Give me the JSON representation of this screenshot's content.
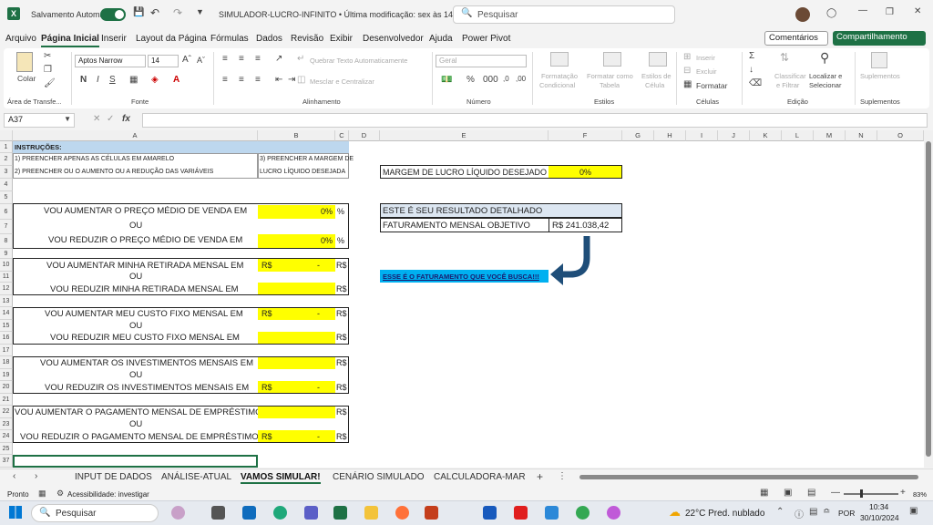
{
  "titlebar": {
    "autosave_label": "Salvamento Automático",
    "doc_title": "SIMULADOR-LUCRO-INFINITO • Última modificação: sex às 14:14",
    "search_placeholder": "Pesquisar"
  },
  "menu": [
    "Arquivo",
    "Página Inicial",
    "Inserir",
    "Layout da Página",
    "Fórmulas",
    "Dados",
    "Revisão",
    "Exibir",
    "Desenvolvedor",
    "Ajuda",
    "Power Pivot"
  ],
  "menu_buttons": {
    "comments": "Comentários",
    "share": "Compartilhamento"
  },
  "ribbon": {
    "paste_label": "Colar",
    "clipboard_group": "Área de Transfe...",
    "font_name": "Aptos Narrow",
    "font_size": "14",
    "font_group": "Fonte",
    "wrap_text": "Quebrar Texto Automaticamente",
    "merge_center": "Mesclar e Centralizar",
    "alignment_group": "Alinhamento",
    "number_format": "Geral",
    "number_group": "Número",
    "cond_format_1": "Formatação",
    "cond_format_2": "Condicional",
    "table_format_1": "Formatar como",
    "table_format_2": "Tabela",
    "cell_styles_1": "Estilos de",
    "cell_styles_2": "Célula",
    "styles_group": "Estilos",
    "insert": "Inserir",
    "delete": "Excluir",
    "format": "Formatar",
    "cells_group": "Células",
    "sort_1": "Classificar",
    "sort_2": "e Filtrar",
    "find_1": "Localizar e",
    "find_2": "Selecionar",
    "editing_group": "Edição",
    "addins": "Suplementos",
    "addins_group": "Suplementos"
  },
  "formula_bar": {
    "name_box": "A37",
    "fx": "fx"
  },
  "columns": [
    "A",
    "B",
    "C",
    "D",
    "E",
    "F",
    "G",
    "H",
    "I",
    "J",
    "K",
    "L",
    "M",
    "N",
    "O"
  ],
  "rows": [
    "1",
    "2",
    "3",
    "4",
    "5",
    "6",
    "7",
    "8",
    "9",
    "10",
    "11",
    "12",
    "13",
    "14",
    "15",
    "16",
    "17",
    "18",
    "19",
    "20",
    "21",
    "22",
    "23",
    "24",
    "25",
    "37"
  ],
  "sheet": {
    "instructions_title": "INSTRUÇÕES:",
    "instr1": "1) PREENCHER APENAS AS CÉLULAS EM AMARELO",
    "instr2": "2) PREENCHER OU O AUMENTO OU A REDUÇÃO DAS VARIÁVEIS",
    "instr3a": "3) PREENCHER A MARGEM DE",
    "instr3b": "LUCRO LÍQUIDO DESEJADA",
    "price_up": "VOU AUMENTAR O PREÇO MÉDIO DE VENDA EM",
    "or": "OU",
    "price_down": "VOU REDUZIR O PREÇO MÉDIO DE VENDA EM",
    "price_up_val": "0%",
    "price_down_val": "0%",
    "pct": "%",
    "withdraw_up": "VOU AUMENTAR MINHA RETIRADA MENSAL EM",
    "withdraw_down": "VOU REDUZIR MINHA RETIRADA MENSAL EM",
    "rs": "R$",
    "dash": "-",
    "fixed_up": "VOU AUMENTAR MEU CUSTO FIXO MENSAL  EM",
    "fixed_down": "VOU REDUZIR MEU CUSTO FIXO MENSAL EM",
    "invest_up": "VOU AUMENTAR OS INVESTIMENTOS MENSAIS EM",
    "invest_down": "VOU REDUZIR OS INVESTIMENTOS MENSAIS EM",
    "loan_up": "VOU AUMENTAR O PAGAMENTO MENSAL DE EMPRÉSTIMOS  EM",
    "loan_down": "VOU REDUZIR O PAGAMENTO MENSAL  DE EMPRÉSTIMOS EM",
    "margin_label": "MARGEM DE LUCRO LÍQUIDO DESEJADO",
    "margin_val": "0%",
    "result_title": "ESTE É SEU RESULTADO DETALHADO",
    "revenue_label": "FATURAMENTO MENSAL OBJETIVO",
    "revenue_val": "R$  241.038,42",
    "revenue_note": "ESSE É O FATURAMENTO QUE VOCÊ BUSCA!!!"
  },
  "tabs": [
    "INPUT DE DADOS",
    "ANÁLISE-ATUAL",
    "VAMOS SIMULAR!",
    "CENÁRIO SIMULADO",
    "CALCULADORA-MAR"
  ],
  "status": {
    "ready": "Pronto",
    "accessibility": "Acessibilidade: investigar",
    "zoom": "83%"
  },
  "taskbar": {
    "search": "Pesquisar",
    "weather": "22°C  Pred. nublado",
    "lang": "POR",
    "time": "10:34",
    "date": "30/10/2024"
  },
  "colors": {
    "excel_green": "#1e7145",
    "yellow": "#ffff00",
    "result_blue": "#dce6f1",
    "note_blue": "#00b0f0",
    "arrow": "#1f4e79"
  }
}
